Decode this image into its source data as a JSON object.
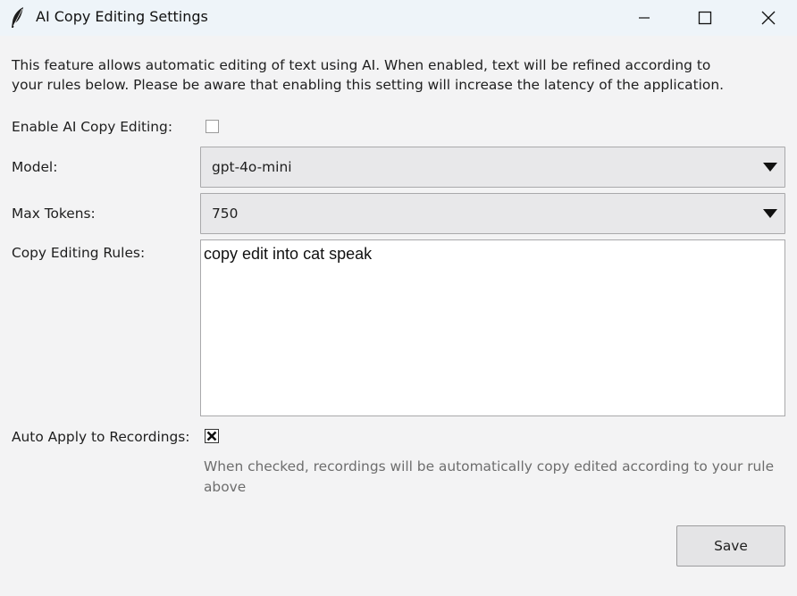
{
  "window": {
    "title": "AI Copy Editing Settings",
    "icon": "feather-icon",
    "controls": [
      "minimize-icon",
      "maximize-icon",
      "close-icon"
    ]
  },
  "intro": {
    "line1": "This feature allows automatic editing of text using AI. When enabled, text will be refined according to",
    "line2": "your rules below. Please be aware that enabling this setting will increase the latency of the application."
  },
  "form": {
    "enable_label": "Enable AI Copy Editing:",
    "enable_checked": false,
    "model_label": "Model:",
    "model_value": "gpt-4o-mini",
    "max_tokens_label": "Max Tokens:",
    "max_tokens_value": "750",
    "rules_label": "Copy Editing Rules:",
    "rules_value": "copy edit into cat speak",
    "auto_apply_label": "Auto Apply to Recordings:",
    "auto_apply_checked": true,
    "auto_apply_help_line1": "When checked, recordings will be automatically copy edited according to your rule",
    "auto_apply_help_line2": "above"
  },
  "footer": {
    "save_label": "Save"
  },
  "colors": {
    "titlebar": "#eef4f9",
    "background": "#f3f3f4",
    "select_bg": "#e8e8ea",
    "help_text": "#6d6d6d"
  }
}
